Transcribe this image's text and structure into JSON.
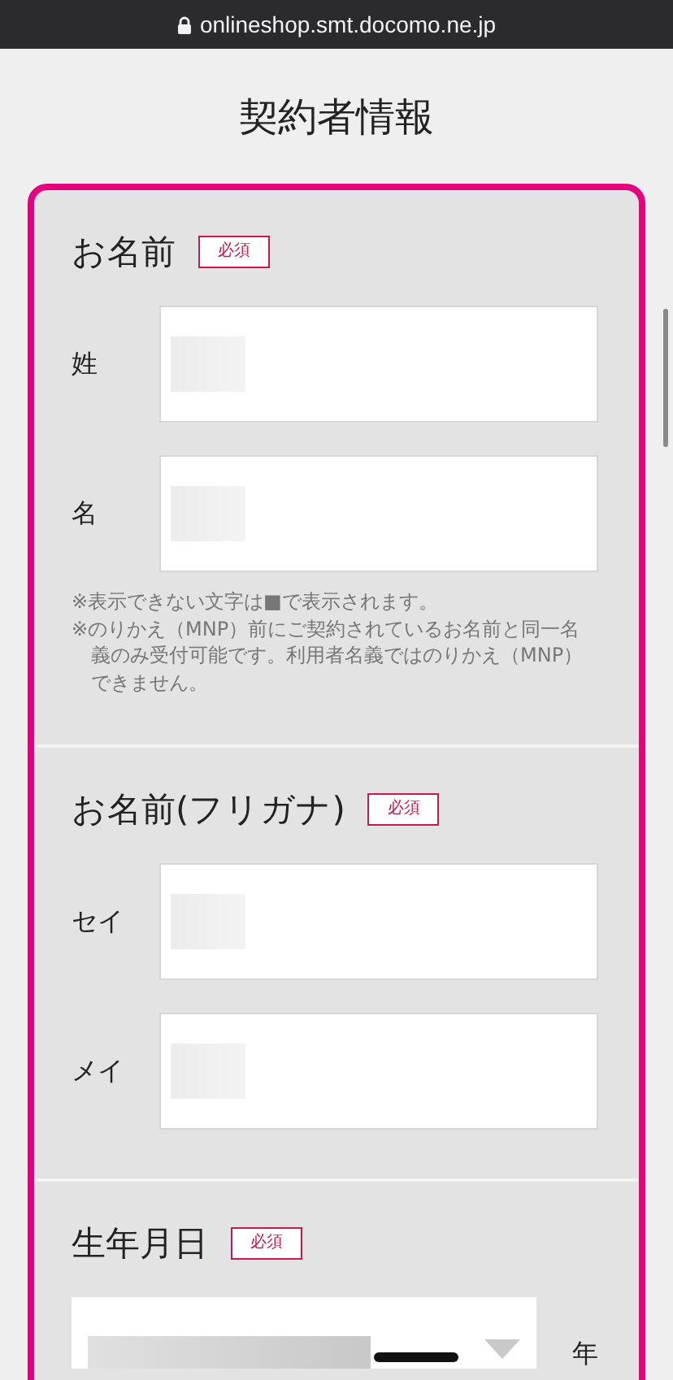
{
  "address_bar": {
    "url": "onlineshop.smt.docomo.ne.jp"
  },
  "page_title": "契約者情報",
  "sections": [
    {
      "heading": "お名前",
      "badge": "必須",
      "fields": [
        {
          "kind": "text",
          "label": "姓",
          "redacted": true
        },
        {
          "kind": "text",
          "label": "名",
          "redacted": true
        }
      ],
      "notes": [
        "※表示できない文字は■で表示されます。",
        "※のりかえ（MNP）前にご契約されているお名前と同一名義のみ受付可能です。利用者名義ではのりかえ（MNP）できません。"
      ]
    },
    {
      "heading": "お名前(フリガナ)",
      "badge": "必須",
      "fields": [
        {
          "kind": "text",
          "label": "セイ",
          "redacted": true
        },
        {
          "kind": "text",
          "label": "メイ",
          "redacted": true
        }
      ]
    },
    {
      "heading": "生年月日",
      "badge": "必須",
      "fields": [
        {
          "kind": "select",
          "unit": "年",
          "redacted": true
        }
      ]
    }
  ]
}
